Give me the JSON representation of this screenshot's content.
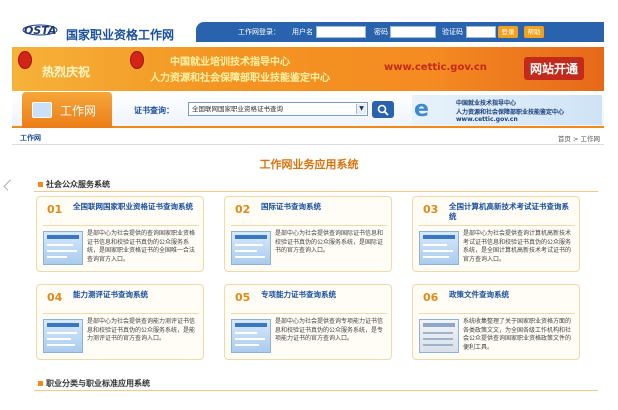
{
  "header": {
    "logo_text": "OSTA",
    "site_title": "国家职业资格工作网",
    "login_label": "工作网登录：",
    "username_label": "用户名",
    "password_label": "密码",
    "captcha_label": "验证码",
    "login_button": "登录",
    "help_button": "帮助"
  },
  "banner": {
    "left_text": "热烈庆祝",
    "line1": "中国就业培训技术指导中心",
    "line2": "人力资源和社会保障部职业技能鉴定中心",
    "url": "www.cettic.gov.cn",
    "open_text": "网站开通"
  },
  "search": {
    "home_tab": "工作网",
    "label": "证书查询：",
    "selected_option": "全国联网国家职业资格证书查询",
    "partner_line1": "中国就业技术指导中心",
    "partner_line2": "人力资源和社会保障部职业技能鉴定中心",
    "partner_line3": "www.cettic.gov.cn"
  },
  "breadcrumb": {
    "left": "工作网",
    "right": "首页 > 工作网"
  },
  "main": {
    "title": "工作网业务应用系统",
    "section1": "社会公众服务系统",
    "section2": "职业分类与职业标准应用系统",
    "cards": [
      {
        "num": "01",
        "title": "全国联网国家职业资格证书查询系统",
        "desc": "是部中心为社会提供的查询国家职业资格证书信息和校验证书真伪的公众服务系统，是国家职业资格证书的全国唯一合法查询官方入口。"
      },
      {
        "num": "02",
        "title": "国际证书查询系统",
        "desc": "是部中心为社会提供查询国际证书信息和校验证书真伪的公众服务系统，是国际证书的官方查询入口。"
      },
      {
        "num": "03",
        "title": "全国计算机高新技术考试证书查询系统",
        "desc": "是部中心为社会提供查询计算机高新技术考试证书信息和校验证书真伪的公众服务系统，是全国计算机高新技术考试证书的官方查询入口。"
      },
      {
        "num": "04",
        "title": "能力测评证书查询系统",
        "desc": "是部中心为社会提供查询能力测评证书信息和校验证书真伪的公众服务系统，是能力测评证书的官方查询入口。"
      },
      {
        "num": "05",
        "title": "专项能力证书查询系统",
        "desc": "是部中心为社会提供查询专项能力证书信息和校验证书真伪的公众服务系统，是专项能力证书的官方查询入口。"
      },
      {
        "num": "06",
        "title": "政策文件查询系统",
        "desc": "系统收集整理了关于国家职业资格方面的各类政策文文，为全国各级工作机构和社会公众提供查询国家职业资格政策文件的便利工具。"
      }
    ]
  },
  "colors": {
    "brand_blue": "#2a63ad",
    "accent_orange": "#f28a1a"
  }
}
